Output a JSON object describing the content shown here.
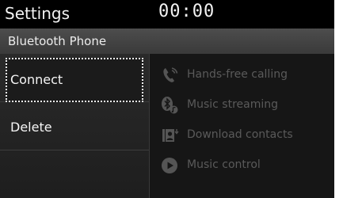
{
  "header": {
    "title": "Settings",
    "clock": "00:00"
  },
  "subheader": {
    "label": "Bluetooth Phone"
  },
  "menu": {
    "items": [
      {
        "label": "Connect"
      },
      {
        "label": "Delete"
      }
    ]
  },
  "features": [
    {
      "label": "Hands-free calling",
      "icon": "phone-handset-icon"
    },
    {
      "label": "Music streaming",
      "icon": "bluetooth-music-icon"
    },
    {
      "label": "Download contacts",
      "icon": "contacts-download-icon"
    },
    {
      "label": "Music control",
      "icon": "play-icon"
    }
  ],
  "colors": {
    "background": "#161616",
    "topbar": "#000000",
    "subbar": "#434343",
    "text": "#f2f2f2",
    "disabled": "#5a5a5a"
  }
}
